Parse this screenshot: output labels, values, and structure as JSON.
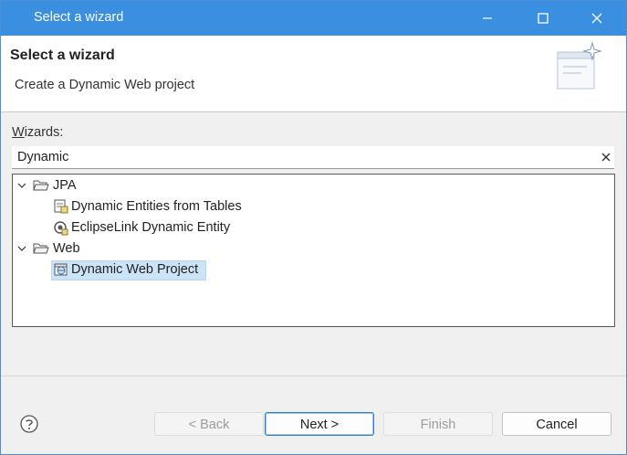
{
  "window": {
    "title": "Select a wizard"
  },
  "header": {
    "title": "Select a wizard",
    "description": "Create a Dynamic Web project"
  },
  "wizards": {
    "label_prefix": "W",
    "label_rest": "izards:",
    "filter_value": "Dynamic"
  },
  "tree": {
    "groups": [
      {
        "label": "JPA",
        "expanded": true,
        "items": [
          {
            "label": "Dynamic Entities from Tables",
            "icon": "jpa-entities-icon"
          },
          {
            "label": "EclipseLink Dynamic Entity",
            "icon": "eclipselink-icon"
          }
        ]
      },
      {
        "label": "Web",
        "expanded": true,
        "items": [
          {
            "label": "Dynamic Web Project",
            "icon": "web-project-icon",
            "selected": true
          }
        ]
      }
    ]
  },
  "buttons": {
    "back": "< Back",
    "next": "Next >",
    "finish": "Finish",
    "cancel": "Cancel"
  },
  "colors": {
    "titlebar": "#3a8fe0",
    "selection": "#cce4f7",
    "default_button_border": "#2f7fd0"
  }
}
